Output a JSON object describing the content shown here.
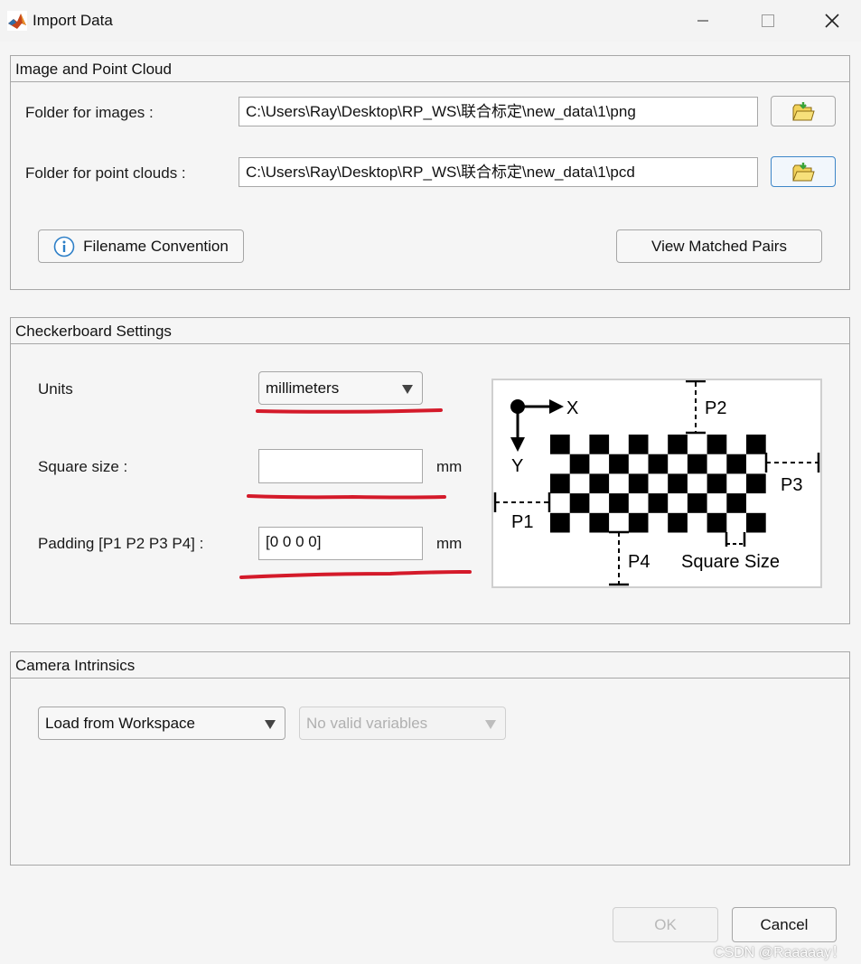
{
  "window": {
    "title": "Import Data"
  },
  "image_pc": {
    "header": "Image and Point Cloud",
    "images_label": "Folder for images :",
    "images_value": "C:\\Users\\Ray\\Desktop\\RP_WS\\联合标定\\new_data\\1\\png",
    "pc_label": "Folder for point clouds :",
    "pc_value": "C:\\Users\\Ray\\Desktop\\RP_WS\\联合标定\\new_data\\1\\pcd",
    "filename_convention": "Filename Convention",
    "view_matched_pairs": "View Matched Pairs"
  },
  "checkerboard": {
    "header": "Checkerboard Settings",
    "units_label": "Units",
    "units_value": "millimeters",
    "square_label": "Square size :",
    "square_value": "",
    "square_unit": "mm",
    "padding_label": "Padding [P1 P2 P3 P4] :",
    "padding_value": "[0 0 0 0]",
    "padding_unit": "mm",
    "diagram": {
      "x": "X",
      "y": "Y",
      "p1": "P1",
      "p2": "P2",
      "p3": "P3",
      "p4": "P4",
      "square_size": "Square Size"
    }
  },
  "intrinsics": {
    "header": "Camera Intrinsics",
    "source_value": "Load from Workspace",
    "variables_value": "No valid variables"
  },
  "footer": {
    "ok": "OK",
    "cancel": "Cancel"
  },
  "watermark": "CSDN @Raaaaay！",
  "colors": {
    "annotation_red": "#d41a2a",
    "focus_blue": "#3d86c8",
    "info_blue": "#2d7fc7",
    "folder_yellow": "#f2d25a",
    "folder_green": "#3aa338"
  }
}
